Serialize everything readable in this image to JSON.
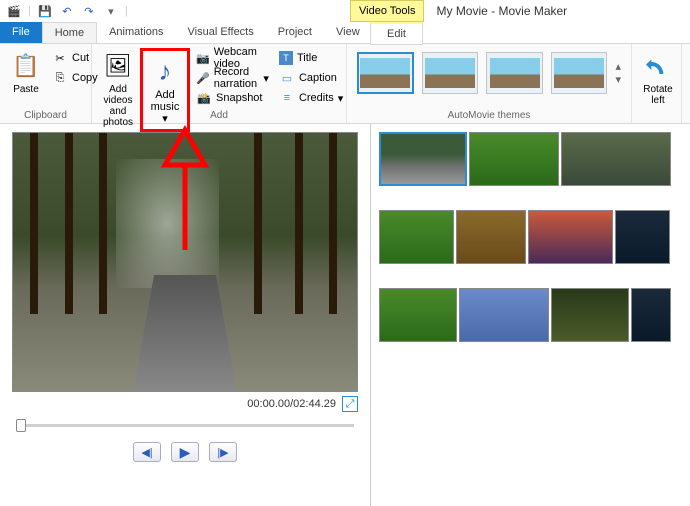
{
  "qat": {
    "save": "💾",
    "undo": "↶",
    "redo": "↷"
  },
  "contextTab": "Video Tools",
  "appTitle": "My Movie - Movie Maker",
  "tabs": {
    "file": "File",
    "home": "Home",
    "animations": "Animations",
    "visualEffects": "Visual Effects",
    "project": "Project",
    "view": "View",
    "edit": "Edit"
  },
  "ribbon": {
    "clipboard": {
      "paste": "Paste",
      "cut": "Cut",
      "copy": "Copy",
      "label": "Clipboard"
    },
    "add": {
      "addVideos": "Add videos\nand photos",
      "addMusic": "Add\nmusic",
      "webcam": "Webcam video",
      "record": "Record narration",
      "snapshot": "Snapshot",
      "title": "Title",
      "caption": "Caption",
      "credits": "Credits",
      "label": "Add"
    },
    "themes": {
      "label": "AutoMovie themes"
    },
    "rotate": {
      "left": "Rotate\nleft"
    }
  },
  "preview": {
    "time": "00:00.00/02:44.29"
  },
  "icons": {
    "dropdown": "▾",
    "play": "▶",
    "prev": "◀|",
    "next": "|▶",
    "expand": "⤢",
    "scissors": "✂",
    "clipboard": "📋",
    "photos": "🖼",
    "music": "♪",
    "webcam": "📷",
    "mic": "🎤",
    "snap": "📸",
    "titleT": "T",
    "caption": "▭",
    "credits": "≡"
  }
}
